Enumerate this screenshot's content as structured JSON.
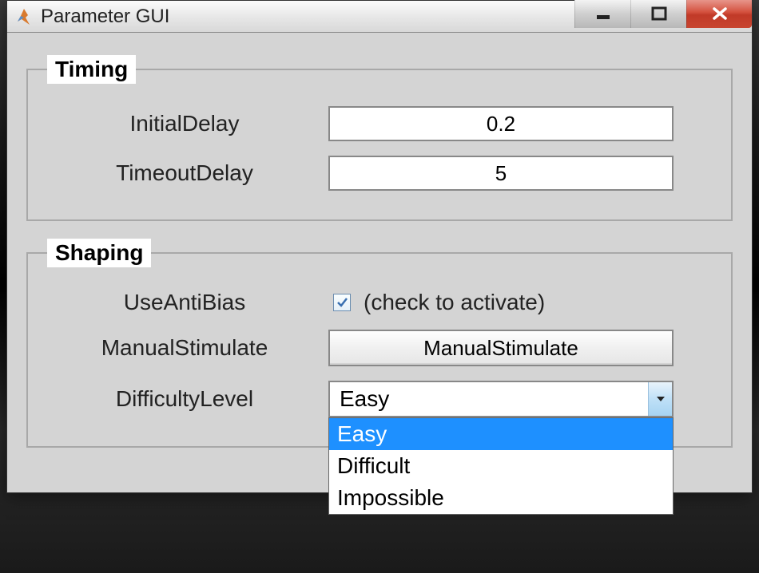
{
  "window": {
    "title": "Parameter GUI"
  },
  "timing": {
    "legend": "Timing",
    "initialDelay": {
      "label": "InitialDelay",
      "value": "0.2"
    },
    "timeoutDelay": {
      "label": "TimeoutDelay",
      "value": "5"
    }
  },
  "shaping": {
    "legend": "Shaping",
    "useAntiBias": {
      "label": "UseAntiBias",
      "checked": true,
      "hint": "(check to activate)"
    },
    "manualStimulate": {
      "label": "ManualStimulate",
      "button": "ManualStimulate"
    },
    "difficultyLevel": {
      "label": "DifficultyLevel",
      "selected": "Easy",
      "options": [
        "Easy",
        "Difficult",
        "Impossible"
      ]
    }
  }
}
